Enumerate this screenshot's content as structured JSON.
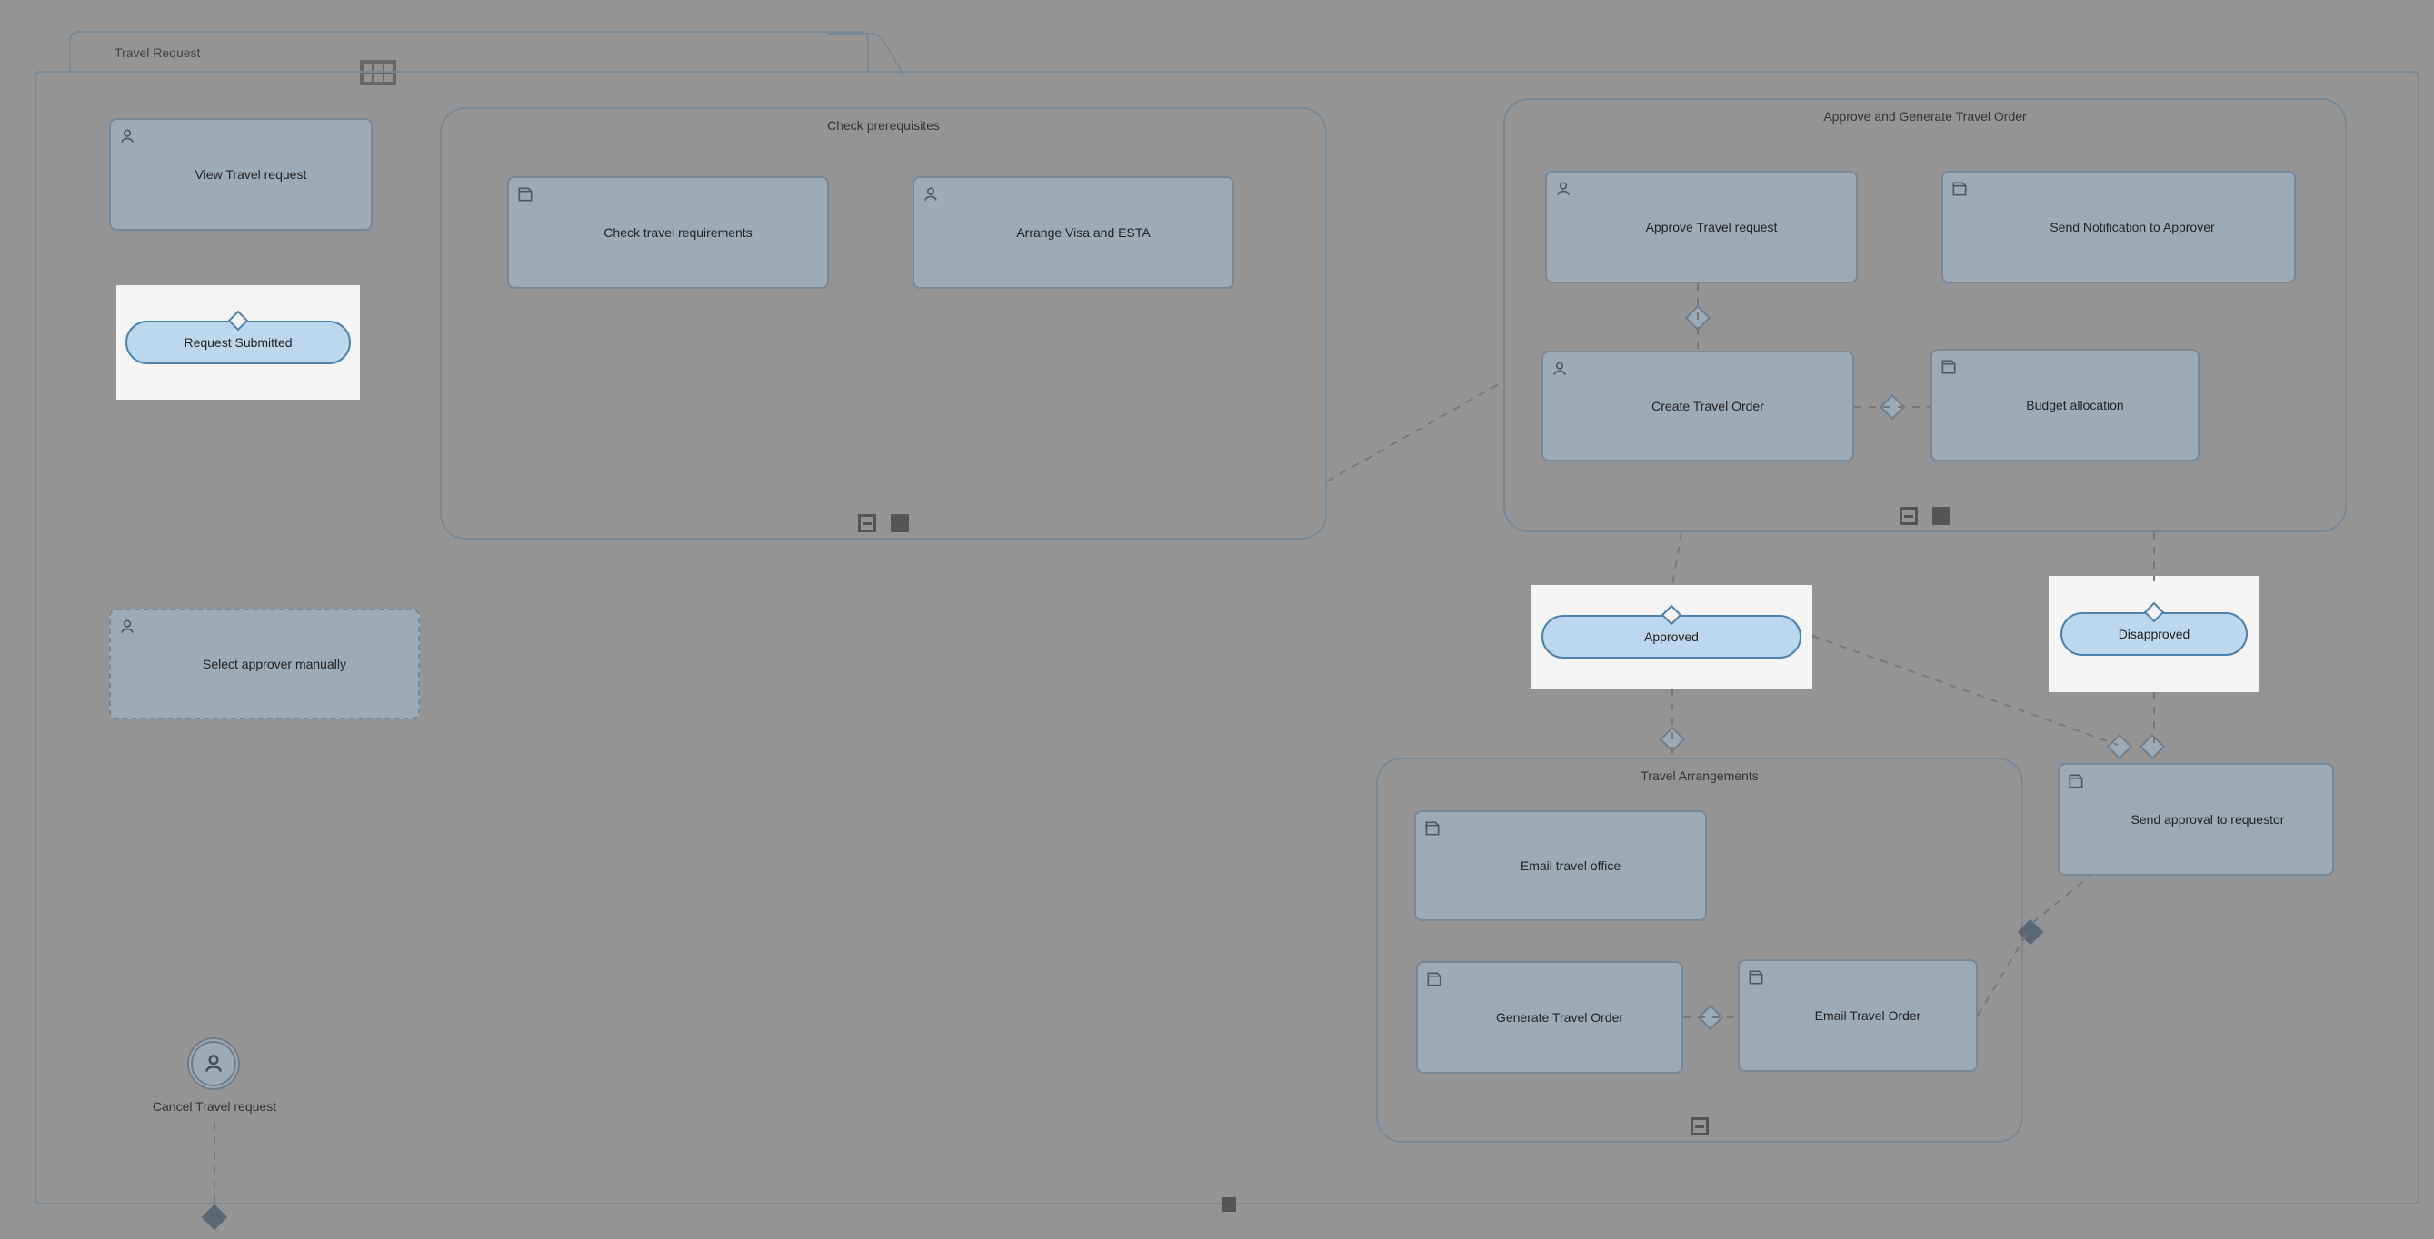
{
  "process": {
    "title": "Travel Request"
  },
  "tasks": {
    "view_travel_request": "View Travel request",
    "check_travel_requirements": "Check travel requirements",
    "arrange_visa_esta": "Arrange Visa and ESTA",
    "select_approver_manually": "Select approver manually",
    "approve_travel_request": "Approve Travel request",
    "send_notification_approver": "Send Notification to Approver",
    "create_travel_order": "Create Travel Order",
    "budget_allocation": "Budget allocation",
    "email_travel_office": "Email travel office",
    "generate_travel_order": "Generate Travel Order",
    "email_travel_order": "Email Travel Order",
    "send_approval_requestor": "Send approval to requestor"
  },
  "subprocesses": {
    "check_prereq": "Check prerequisites",
    "approve_generate": "Approve and Generate Travel Order",
    "travel_arrangements": "Travel Arrangements"
  },
  "milestones": {
    "request_submitted": "Request Submitted",
    "approved": "Approved",
    "disapproved": "Disapproved"
  },
  "adhoc": {
    "cancel_travel_request": "Cancel Travel request"
  },
  "icons": {
    "user": "user-icon",
    "script": "script-icon",
    "grid": "grid-icon"
  },
  "colors": {
    "pill_fill": "#bdd7ee",
    "pill_stroke": "#4e80a9",
    "task_fill": "#9dabb6",
    "task_stroke": "#768795",
    "canvas_overlay": "#949494"
  }
}
